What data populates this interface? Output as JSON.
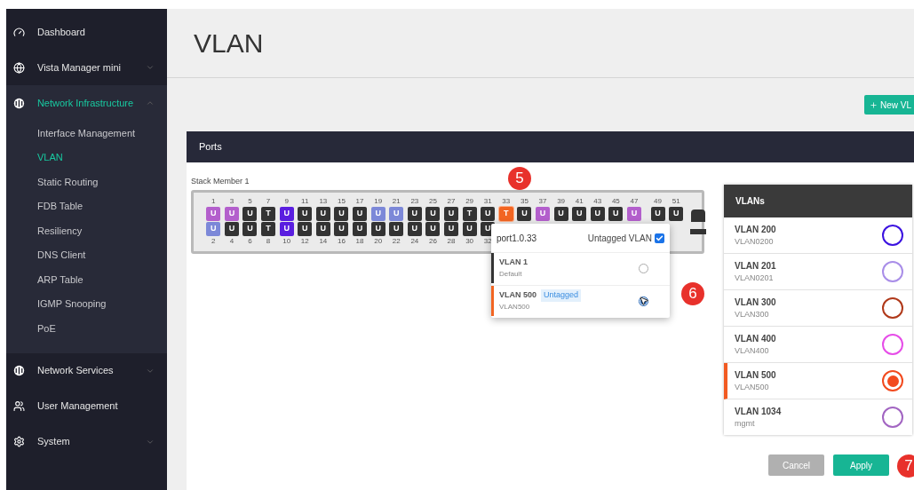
{
  "sidebar": {
    "items": [
      {
        "label": "Dashboard",
        "kind": "link",
        "selected": false
      },
      {
        "label": "Vista Manager mini",
        "kind": "group",
        "selected": false,
        "expanded": false
      },
      {
        "label": "Network Infrastructure",
        "kind": "group",
        "selected": true,
        "expanded": true,
        "children": [
          {
            "label": "Interface Management",
            "selected": false
          },
          {
            "label": "VLAN",
            "selected": true
          },
          {
            "label": "Static Routing",
            "selected": false
          },
          {
            "label": "FDB Table",
            "selected": false
          },
          {
            "label": "Resiliency",
            "selected": false
          },
          {
            "label": "DNS Client",
            "selected": false
          },
          {
            "label": "ARP Table",
            "selected": false
          },
          {
            "label": "IGMP Snooping",
            "selected": false
          },
          {
            "label": "PoE",
            "selected": false
          }
        ]
      },
      {
        "label": "Network Services",
        "kind": "group",
        "selected": false,
        "expanded": false
      },
      {
        "label": "User Management",
        "kind": "link",
        "selected": false
      },
      {
        "label": "System",
        "kind": "group",
        "selected": false,
        "expanded": false
      }
    ]
  },
  "page": {
    "title": "VLAN",
    "new_button": "New VL"
  },
  "ports_panel": {
    "title": "Ports",
    "stack_label": "Stack Member 1",
    "groups": [
      {
        "columns": [
          {
            "top": {
              "label": "1",
              "letter": "U",
              "color": "#b35fcc",
              "selected": false
            },
            "bottom": {
              "label": "2",
              "letter": "U",
              "color": "#7c88d8",
              "selected": false
            }
          },
          {
            "top": {
              "label": "3",
              "letter": "U",
              "color": "#b35fcc",
              "selected": false
            },
            "bottom": {
              "label": "4",
              "letter": "U",
              "color": "#333333",
              "selected": false
            }
          },
          {
            "top": {
              "label": "5",
              "letter": "U",
              "color": "#333333",
              "selected": false
            },
            "bottom": {
              "label": "6",
              "letter": "U",
              "color": "#333333",
              "selected": false
            }
          },
          {
            "top": {
              "label": "7",
              "letter": "T",
              "color": "#333333",
              "selected": false
            },
            "bottom": {
              "label": "8",
              "letter": "T",
              "color": "#333333",
              "selected": false
            }
          },
          {
            "top": {
              "label": "9",
              "letter": "U",
              "color": "#5a1ee0",
              "selected": false
            },
            "bottom": {
              "label": "10",
              "letter": "U",
              "color": "#5a1ee0",
              "selected": false
            }
          },
          {
            "top": {
              "label": "11",
              "letter": "U",
              "color": "#333333",
              "selected": false
            },
            "bottom": {
              "label": "12",
              "letter": "U",
              "color": "#333333",
              "selected": false
            }
          },
          {
            "top": {
              "label": "13",
              "letter": "U",
              "color": "#333333",
              "selected": false
            },
            "bottom": {
              "label": "14",
              "letter": "U",
              "color": "#333333",
              "selected": false
            }
          },
          {
            "top": {
              "label": "15",
              "letter": "U",
              "color": "#333333",
              "selected": false
            },
            "bottom": {
              "label": "16",
              "letter": "U",
              "color": "#333333",
              "selected": false
            }
          },
          {
            "top": {
              "label": "17",
              "letter": "U",
              "color": "#333333",
              "selected": false
            },
            "bottom": {
              "label": "18",
              "letter": "U",
              "color": "#333333",
              "selected": false
            }
          },
          {
            "top": {
              "label": "19",
              "letter": "U",
              "color": "#7c88d8",
              "selected": false
            },
            "bottom": {
              "label": "20",
              "letter": "U",
              "color": "#333333",
              "selected": false
            }
          },
          {
            "top": {
              "label": "21",
              "letter": "U",
              "color": "#7c88d8",
              "selected": false
            },
            "bottom": {
              "label": "22",
              "letter": "U",
              "color": "#333333",
              "selected": false
            }
          },
          {
            "top": {
              "label": "23",
              "letter": "U",
              "color": "#333333",
              "selected": false
            },
            "bottom": {
              "label": "24",
              "letter": "U",
              "color": "#333333",
              "selected": false
            }
          },
          {
            "top": {
              "label": "25",
              "letter": "U",
              "color": "#333333",
              "selected": false
            },
            "bottom": {
              "label": "26",
              "letter": "U",
              "color": "#333333",
              "selected": false
            }
          },
          {
            "top": {
              "label": "27",
              "letter": "U",
              "color": "#333333",
              "selected": false
            },
            "bottom": {
              "label": "28",
              "letter": "U",
              "color": "#333333",
              "selected": false
            }
          },
          {
            "top": {
              "label": "29",
              "letter": "T",
              "color": "#333333",
              "selected": false
            },
            "bottom": {
              "label": "30",
              "letter": "U",
              "color": "#333333",
              "selected": false
            }
          },
          {
            "top": {
              "label": "31",
              "letter": "U",
              "color": "#333333",
              "selected": false
            },
            "bottom": {
              "label": "32",
              "letter": "U",
              "color": "#333333",
              "selected": false
            }
          },
          {
            "top": {
              "label": "33",
              "letter": "T",
              "color": "#f26522",
              "selected": true
            }
          },
          {
            "top": {
              "label": "35",
              "letter": "U",
              "color": "#333333",
              "selected": false
            }
          },
          {
            "top": {
              "label": "37",
              "letter": "U",
              "color": "#b35fcc",
              "selected": false
            }
          },
          {
            "top": {
              "label": "39",
              "letter": "U",
              "color": "#333333",
              "selected": false
            }
          },
          {
            "top": {
              "label": "41",
              "letter": "U",
              "color": "#333333",
              "selected": false
            }
          },
          {
            "top": {
              "label": "43",
              "letter": "U",
              "color": "#333333",
              "selected": false
            }
          },
          {
            "top": {
              "label": "45",
              "letter": "U",
              "color": "#333333",
              "selected": false
            }
          },
          {
            "top": {
              "label": "47",
              "letter": "U",
              "color": "#b35fcc",
              "selected": false
            }
          }
        ]
      },
      {
        "columns": [
          {
            "top": {
              "label": "49",
              "letter": "U",
              "color": "#333333",
              "selected": false
            }
          },
          {
            "top": {
              "label": "51",
              "letter": "U",
              "color": "#333333",
              "selected": false
            }
          }
        ]
      }
    ],
    "popup": {
      "port": "port1.0.33",
      "untagged_label": "Untagged VLAN",
      "untagged_checked": true,
      "rows": [
        {
          "name": "VLAN 1",
          "description": "Default",
          "color": "#333333",
          "selected": false
        },
        {
          "name": "VLAN 500",
          "badge": "Untagged",
          "description": "VLAN500",
          "color": "#f26522",
          "selected": true
        }
      ]
    }
  },
  "vlans_panel": {
    "title": "VLANs",
    "rows": [
      {
        "name": "VLAN 200",
        "description": "VLAN0200",
        "color": "#3b12e0",
        "selected": false
      },
      {
        "name": "VLAN 201",
        "description": "VLAN0201",
        "color": "#a98ee8",
        "selected": false
      },
      {
        "name": "VLAN 300",
        "description": "VLAN300",
        "color": "#b0391a",
        "selected": false
      },
      {
        "name": "VLAN 400",
        "description": "VLAN400",
        "color": "#e64de8",
        "selected": false
      },
      {
        "name": "VLAN 500",
        "description": "VLAN500",
        "color": "#f24a1e",
        "selected": true
      },
      {
        "name": "VLAN 1034",
        "description": "mgmt",
        "color": "#a265c2",
        "selected": false
      }
    ]
  },
  "buttons": [
    {
      "label": "Cancel",
      "kind": "secondary"
    },
    {
      "label": "Apply",
      "kind": "primary"
    }
  ],
  "callouts": [
    "5",
    "6",
    "7"
  ]
}
